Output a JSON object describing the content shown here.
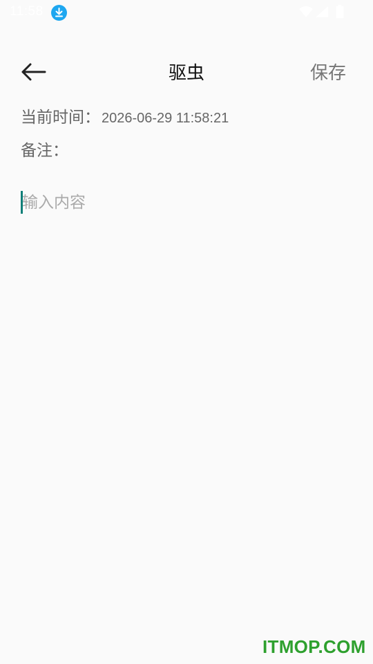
{
  "status_bar": {
    "time": "11:58",
    "icons": [
      "download-icon",
      "wifi-icon",
      "signal-icon",
      "battery-icon"
    ],
    "download_icon_color": "#1ea7f0"
  },
  "toolbar": {
    "back_icon": "arrow-left-icon",
    "title": "驱虫",
    "save_label": "保存"
  },
  "info": {
    "time_label": "当前时间：",
    "time_value": "2026-06-29 11:58:21",
    "note_label": "备注："
  },
  "content_input": {
    "value": "",
    "placeholder": "输入内容"
  },
  "watermark": {
    "text": "ITMOP.COM",
    "color": "#2ea02e"
  },
  "colors": {
    "background": "#fafafa",
    "cursor": "#0f7f78",
    "secondary_text": "#666666",
    "placeholder": "#aaaaaa"
  }
}
